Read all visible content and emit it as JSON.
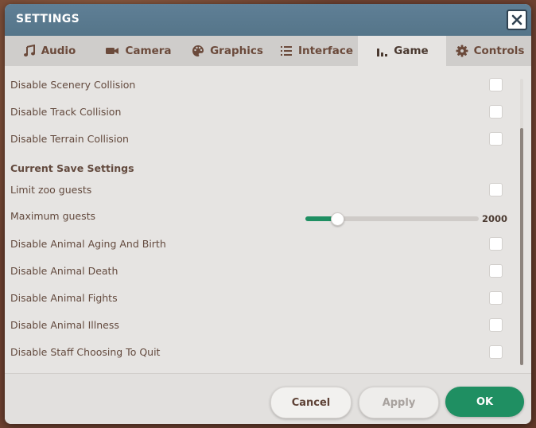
{
  "window": {
    "title": "SETTINGS"
  },
  "tabs": [
    {
      "id": "audio",
      "label": "Audio",
      "icon": "music-note-icon",
      "active": false
    },
    {
      "id": "camera",
      "label": "Camera",
      "icon": "video-camera-icon",
      "active": false
    },
    {
      "id": "graphics",
      "label": "Graphics",
      "icon": "palette-icon",
      "active": false
    },
    {
      "id": "interface",
      "label": "Interface",
      "icon": "list-icon",
      "active": false
    },
    {
      "id": "game",
      "label": "Game",
      "icon": "bar-chart-icon",
      "active": true
    },
    {
      "id": "controls",
      "label": "Controls",
      "icon": "gear-icon",
      "active": false
    }
  ],
  "settings": {
    "disable_scenery_collision": {
      "label": "Disable Scenery Collision",
      "checked": false
    },
    "disable_track_collision": {
      "label": "Disable Track Collision",
      "checked": false
    },
    "disable_terrain_collision": {
      "label": "Disable Terrain Collision",
      "checked": false
    },
    "section_current_save": "Current Save Settings",
    "limit_zoo_guests": {
      "label": "Limit zoo guests",
      "checked": false
    },
    "maximum_guests": {
      "label": "Maximum guests",
      "value": "2000",
      "slider_fraction": 0.18
    },
    "disable_animal_aging": {
      "label": "Disable Animal Aging And Birth",
      "checked": false
    },
    "disable_animal_death": {
      "label": "Disable Animal Death",
      "checked": false
    },
    "disable_animal_fights": {
      "label": "Disable Animal Fights",
      "checked": false
    },
    "disable_animal_illness": {
      "label": "Disable Animal Illness",
      "checked": false
    },
    "disable_staff_quit": {
      "label": "Disable Staff Choosing To Quit",
      "checked": false
    }
  },
  "footer": {
    "cancel_label": "Cancel",
    "apply_label": "Apply",
    "ok_label": "OK"
  },
  "colors": {
    "accent": "#1f8f62",
    "titlebar": "#5a7a90",
    "text": "#634a3e"
  }
}
